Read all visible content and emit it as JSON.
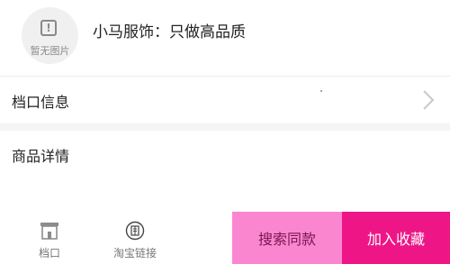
{
  "shop": {
    "no_image_text": "暂无图片",
    "name": "小马服饰：只做高品质"
  },
  "rows": {
    "stall_info_label": "档口信息",
    "product_detail_label": "商品详情"
  },
  "bottom_bar": {
    "stall_label": "档口",
    "taobao_label": "淘宝链接",
    "search_same_label": "搜索同款",
    "add_favorite_label": "加入收藏"
  },
  "colors": {
    "search_button": "#fb86d0",
    "favorite_button": "#ee1686",
    "page_background": "#ffffff",
    "separator_band": "#f5f5f5"
  },
  "icons": {
    "placeholder": "exclamation-box-icon",
    "row_arrow": "chevron-right-icon",
    "stall": "storefront-icon",
    "taobao": "taobao-icon"
  }
}
